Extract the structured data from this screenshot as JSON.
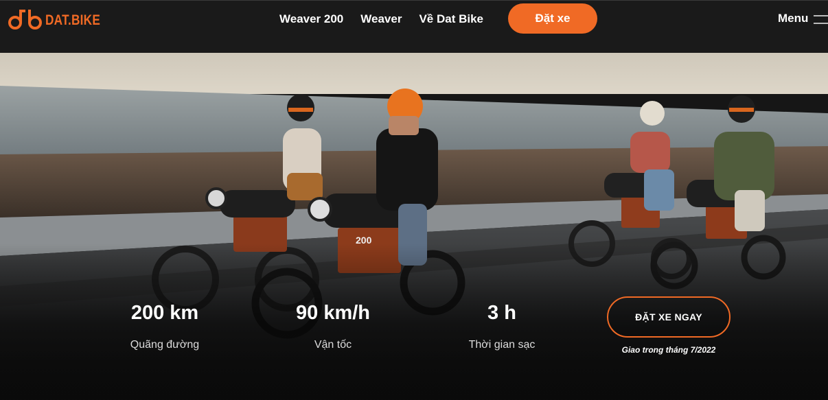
{
  "nav": {
    "logo_text": "DAT.BIKE",
    "links": [
      "Weaver 200",
      "Weaver",
      "Về Dat Bike"
    ],
    "cta": "Đặt xe",
    "menu_label": "Menu"
  },
  "hero": {
    "stats": [
      {
        "value": "200 km",
        "label": "Quãng đường"
      },
      {
        "value": "90 km/h",
        "label": "Vận tốc"
      },
      {
        "value": "3 h",
        "label": "Thời gian sạc"
      }
    ],
    "order_button": "ĐẶT XE NGAY",
    "delivery_note": "Giao trong tháng 7/2022",
    "bike_badge": "200"
  },
  "colors": {
    "brand_orange": "#f06a25",
    "nav_bg": "#1a1a1a",
    "sky": "#d8d2c6",
    "sea": "#8a9499"
  },
  "icons": [
    "bike-logo-icon",
    "hamburger-icon"
  ]
}
